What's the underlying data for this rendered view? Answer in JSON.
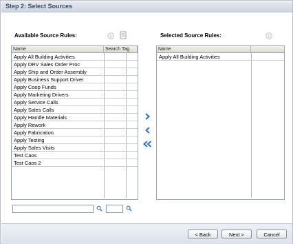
{
  "step_title": "Step 2: Select Sources",
  "available": {
    "title": "Available Source Rules:",
    "columns": [
      "Name",
      "Search Tag"
    ],
    "rows": [
      "Apply All Building Activities",
      "Apply DRV Sales Order Proc",
      "Apply Ship and Order Assembly",
      "Apply Business Support Driver",
      "Apply Coop Funds",
      "Apply Marketing Drivers",
      "Apply Service Calls",
      "Apply Sales Calls",
      "Apply Handle Materials",
      "Apply Rework",
      "Apply Fabrication",
      "Apply Testing",
      "Apply Sales Visits",
      "Test Caos",
      "Test Caos 2"
    ],
    "icons": [
      "info-icon",
      "document-icon"
    ]
  },
  "selected": {
    "title": "Selected Source Rules:",
    "columns": [
      "Name"
    ],
    "rows": [
      "Apply All Building Activities"
    ],
    "icons": [
      "info-icon"
    ]
  },
  "search": {
    "name_value": "",
    "tag_value": ""
  },
  "move_buttons": [
    "move-right-icon",
    "move-left-icon",
    "move-all-left-icon"
  ],
  "footer": {
    "back_label": "< Back",
    "next_label": "Next >",
    "cancel_label": "Cancel"
  },
  "colors": {
    "accent_blue": "#2f6fc4",
    "header_text": "#3a4b66"
  }
}
